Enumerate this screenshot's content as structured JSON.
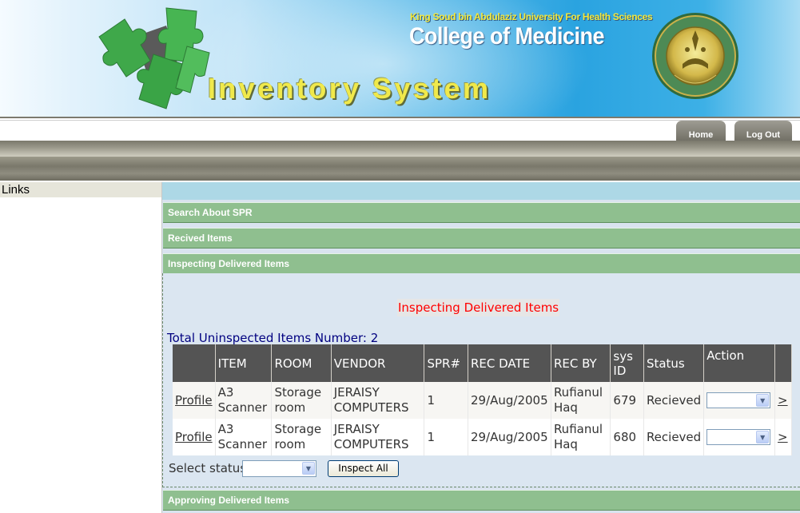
{
  "header": {
    "university": "King Soud bin Abdulaziz University For Health Sciences",
    "college": "College of Medicine",
    "system_title": "Inventory System",
    "brand_yellow": "#f0e94b",
    "puzzle_icon": "puzzle-pieces-logo",
    "seal_icon": "university-seal"
  },
  "nav": {
    "home": "Home",
    "logout": "Log Out"
  },
  "sidebar": {
    "heading": "Links"
  },
  "sections": {
    "search_spr": "Search About SPR",
    "received_items": "Recived Items",
    "inspecting": "Inspecting Delivered Items",
    "approving": "Approving Delivered Items"
  },
  "panel": {
    "title": "Inspecting Delivered Items",
    "total": "Total Uninspected Items Number: 2",
    "columns": [
      "",
      "ITEM",
      "ROOM",
      "VENDOR",
      "SPR#",
      "REC DATE",
      "REC BY",
      "sys ID",
      "Status",
      "Action",
      ""
    ],
    "rows": [
      {
        "link": "Profile",
        "item": "A3 Scanner",
        "room": "Storage room",
        "vendor": "JERAISY COMPUTERS",
        "spr": "1",
        "rec_date": "29/Aug/2005",
        "rec_by": "Rufianul Haq",
        "sys_id": "679",
        "status": "Recieved",
        "go": ">"
      },
      {
        "link": "Profile",
        "item": "A3 Scanner",
        "room": "Storage room",
        "vendor": "JERAISY COMPUTERS",
        "spr": "1",
        "rec_date": "29/Aug/2005",
        "rec_by": "Rufianul Haq",
        "sys_id": "680",
        "status": "Recieved",
        "go": ">"
      }
    ],
    "select_status_label": "Select status",
    "inspect_all": "Inspect All"
  },
  "colors": {
    "accordion_green": "#8fbf8f",
    "panel_title_red": "#ff0000",
    "total_navy": "#000080",
    "grid_header": "#545454"
  }
}
